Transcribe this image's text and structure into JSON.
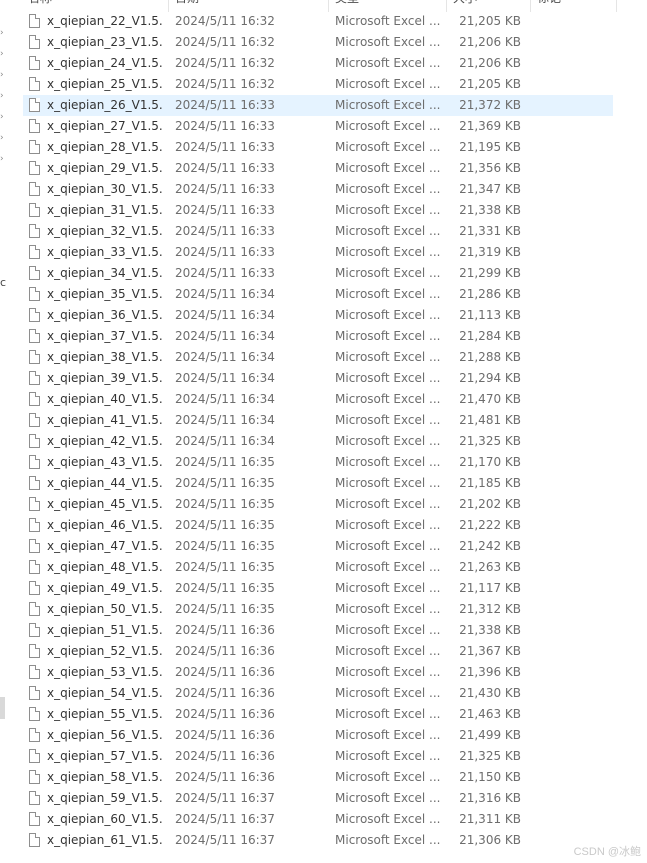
{
  "columns": {
    "name": "名称",
    "date": "日期",
    "type": "类型",
    "size": "大小",
    "tags": "标记"
  },
  "icons": {
    "file": "file-icon",
    "nav_chevron": "chevron-right-icon"
  },
  "nav": {
    "fragment": "c"
  },
  "colors": {
    "selection": "#e5f3ff"
  },
  "files": [
    {
      "name": "x_qiepian_22_V1.5...",
      "date": "2024/5/11 16:32",
      "type": "Microsoft Excel ...",
      "size": "21,205 KB"
    },
    {
      "name": "x_qiepian_23_V1.5...",
      "date": "2024/5/11 16:32",
      "type": "Microsoft Excel ...",
      "size": "21,206 KB"
    },
    {
      "name": "x_qiepian_24_V1.5...",
      "date": "2024/5/11 16:32",
      "type": "Microsoft Excel ...",
      "size": "21,206 KB"
    },
    {
      "name": "x_qiepian_25_V1.5...",
      "date": "2024/5/11 16:32",
      "type": "Microsoft Excel ...",
      "size": "21,205 KB"
    },
    {
      "name": "x_qiepian_26_V1.5...",
      "date": "2024/5/11 16:33",
      "type": "Microsoft Excel ...",
      "size": "21,372 KB",
      "selected": true
    },
    {
      "name": "x_qiepian_27_V1.5...",
      "date": "2024/5/11 16:33",
      "type": "Microsoft Excel ...",
      "size": "21,369 KB"
    },
    {
      "name": "x_qiepian_28_V1.5...",
      "date": "2024/5/11 16:33",
      "type": "Microsoft Excel ...",
      "size": "21,195 KB"
    },
    {
      "name": "x_qiepian_29_V1.5...",
      "date": "2024/5/11 16:33",
      "type": "Microsoft Excel ...",
      "size": "21,356 KB"
    },
    {
      "name": "x_qiepian_30_V1.5...",
      "date": "2024/5/11 16:33",
      "type": "Microsoft Excel ...",
      "size": "21,347 KB"
    },
    {
      "name": "x_qiepian_31_V1.5...",
      "date": "2024/5/11 16:33",
      "type": "Microsoft Excel ...",
      "size": "21,338 KB"
    },
    {
      "name": "x_qiepian_32_V1.5...",
      "date": "2024/5/11 16:33",
      "type": "Microsoft Excel ...",
      "size": "21,331 KB"
    },
    {
      "name": "x_qiepian_33_V1.5...",
      "date": "2024/5/11 16:33",
      "type": "Microsoft Excel ...",
      "size": "21,319 KB"
    },
    {
      "name": "x_qiepian_34_V1.5...",
      "date": "2024/5/11 16:33",
      "type": "Microsoft Excel ...",
      "size": "21,299 KB"
    },
    {
      "name": "x_qiepian_35_V1.5...",
      "date": "2024/5/11 16:34",
      "type": "Microsoft Excel ...",
      "size": "21,286 KB"
    },
    {
      "name": "x_qiepian_36_V1.5...",
      "date": "2024/5/11 16:34",
      "type": "Microsoft Excel ...",
      "size": "21,113 KB"
    },
    {
      "name": "x_qiepian_37_V1.5...",
      "date": "2024/5/11 16:34",
      "type": "Microsoft Excel ...",
      "size": "21,284 KB"
    },
    {
      "name": "x_qiepian_38_V1.5...",
      "date": "2024/5/11 16:34",
      "type": "Microsoft Excel ...",
      "size": "21,288 KB"
    },
    {
      "name": "x_qiepian_39_V1.5...",
      "date": "2024/5/11 16:34",
      "type": "Microsoft Excel ...",
      "size": "21,294 KB"
    },
    {
      "name": "x_qiepian_40_V1.5...",
      "date": "2024/5/11 16:34",
      "type": "Microsoft Excel ...",
      "size": "21,470 KB"
    },
    {
      "name": "x_qiepian_41_V1.5...",
      "date": "2024/5/11 16:34",
      "type": "Microsoft Excel ...",
      "size": "21,481 KB"
    },
    {
      "name": "x_qiepian_42_V1.5...",
      "date": "2024/5/11 16:34",
      "type": "Microsoft Excel ...",
      "size": "21,325 KB"
    },
    {
      "name": "x_qiepian_43_V1.5...",
      "date": "2024/5/11 16:35",
      "type": "Microsoft Excel ...",
      "size": "21,170 KB"
    },
    {
      "name": "x_qiepian_44_V1.5...",
      "date": "2024/5/11 16:35",
      "type": "Microsoft Excel ...",
      "size": "21,185 KB"
    },
    {
      "name": "x_qiepian_45_V1.5...",
      "date": "2024/5/11 16:35",
      "type": "Microsoft Excel ...",
      "size": "21,202 KB"
    },
    {
      "name": "x_qiepian_46_V1.5...",
      "date": "2024/5/11 16:35",
      "type": "Microsoft Excel ...",
      "size": "21,222 KB"
    },
    {
      "name": "x_qiepian_47_V1.5...",
      "date": "2024/5/11 16:35",
      "type": "Microsoft Excel ...",
      "size": "21,242 KB"
    },
    {
      "name": "x_qiepian_48_V1.5...",
      "date": "2024/5/11 16:35",
      "type": "Microsoft Excel ...",
      "size": "21,263 KB"
    },
    {
      "name": "x_qiepian_49_V1.5...",
      "date": "2024/5/11 16:35",
      "type": "Microsoft Excel ...",
      "size": "21,117 KB"
    },
    {
      "name": "x_qiepian_50_V1.5...",
      "date": "2024/5/11 16:35",
      "type": "Microsoft Excel ...",
      "size": "21,312 KB"
    },
    {
      "name": "x_qiepian_51_V1.5...",
      "date": "2024/5/11 16:36",
      "type": "Microsoft Excel ...",
      "size": "21,338 KB"
    },
    {
      "name": "x_qiepian_52_V1.5...",
      "date": "2024/5/11 16:36",
      "type": "Microsoft Excel ...",
      "size": "21,367 KB"
    },
    {
      "name": "x_qiepian_53_V1.5...",
      "date": "2024/5/11 16:36",
      "type": "Microsoft Excel ...",
      "size": "21,396 KB"
    },
    {
      "name": "x_qiepian_54_V1.5...",
      "date": "2024/5/11 16:36",
      "type": "Microsoft Excel ...",
      "size": "21,430 KB"
    },
    {
      "name": "x_qiepian_55_V1.5...",
      "date": "2024/5/11 16:36",
      "type": "Microsoft Excel ...",
      "size": "21,463 KB"
    },
    {
      "name": "x_qiepian_56_V1.5...",
      "date": "2024/5/11 16:36",
      "type": "Microsoft Excel ...",
      "size": "21,499 KB"
    },
    {
      "name": "x_qiepian_57_V1.5...",
      "date": "2024/5/11 16:36",
      "type": "Microsoft Excel ...",
      "size": "21,325 KB"
    },
    {
      "name": "x_qiepian_58_V1.5...",
      "date": "2024/5/11 16:36",
      "type": "Microsoft Excel ...",
      "size": "21,150 KB"
    },
    {
      "name": "x_qiepian_59_V1.5...",
      "date": "2024/5/11 16:37",
      "type": "Microsoft Excel ...",
      "size": "21,316 KB"
    },
    {
      "name": "x_qiepian_60_V1.5...",
      "date": "2024/5/11 16:37",
      "type": "Microsoft Excel ...",
      "size": "21,311 KB"
    },
    {
      "name": "x_qiepian_61_V1.5...",
      "date": "2024/5/11 16:37",
      "type": "Microsoft Excel ...",
      "size": "21,306 KB"
    }
  ],
  "watermark": "CSDN @冰鲍"
}
